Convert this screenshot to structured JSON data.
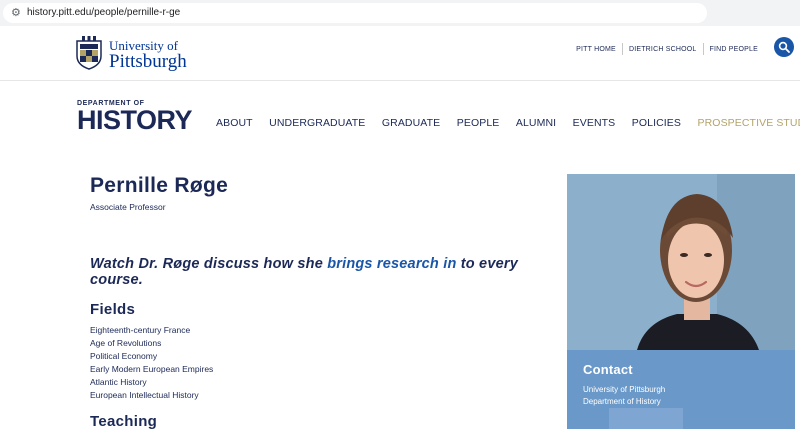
{
  "browser": {
    "url": "history.pitt.edu/people/pernille-r-ge"
  },
  "header": {
    "logo_line1": "University of",
    "logo_line2": "Pittsburgh",
    "utility_nav": [
      "PITT HOME",
      "DIETRICH SCHOOL",
      "FIND PEOPLE"
    ]
  },
  "department": {
    "label_small": "DEPARTMENT OF",
    "label_big": "HISTORY"
  },
  "main_nav": {
    "items": [
      "ABOUT",
      "UNDERGRADUATE",
      "GRADUATE",
      "PEOPLE",
      "ALUMNI",
      "EVENTS",
      "POLICIES"
    ],
    "accent_item": "PROSPECTIVE STUDENTS"
  },
  "profile": {
    "name": "Pernille Røge",
    "title": "Associate Professor",
    "video_prefix": "Watch Dr. Røge discuss how she ",
    "video_link": "brings research in",
    "video_suffix": " to every course."
  },
  "fields": {
    "heading": "Fields",
    "items": [
      "Eighteenth-century France",
      "Age of Revolutions",
      "Political Economy",
      "Early Modern European Empires",
      "Atlantic History",
      "European Intellectual History"
    ]
  },
  "teaching": {
    "heading": "Teaching"
  },
  "contact": {
    "heading": "Contact",
    "line1": "University of Pittsburgh",
    "line2": "Department of History"
  },
  "icons": {
    "site_info": "tune-icon",
    "search": "search-icon",
    "logo": "pitt-shield-icon"
  },
  "colors": {
    "navy": "#1c2957",
    "pitt_blue": "#003594",
    "gold": "#b3a369",
    "link_blue": "#1a56a8",
    "contact_blue": "#6a98c8"
  }
}
